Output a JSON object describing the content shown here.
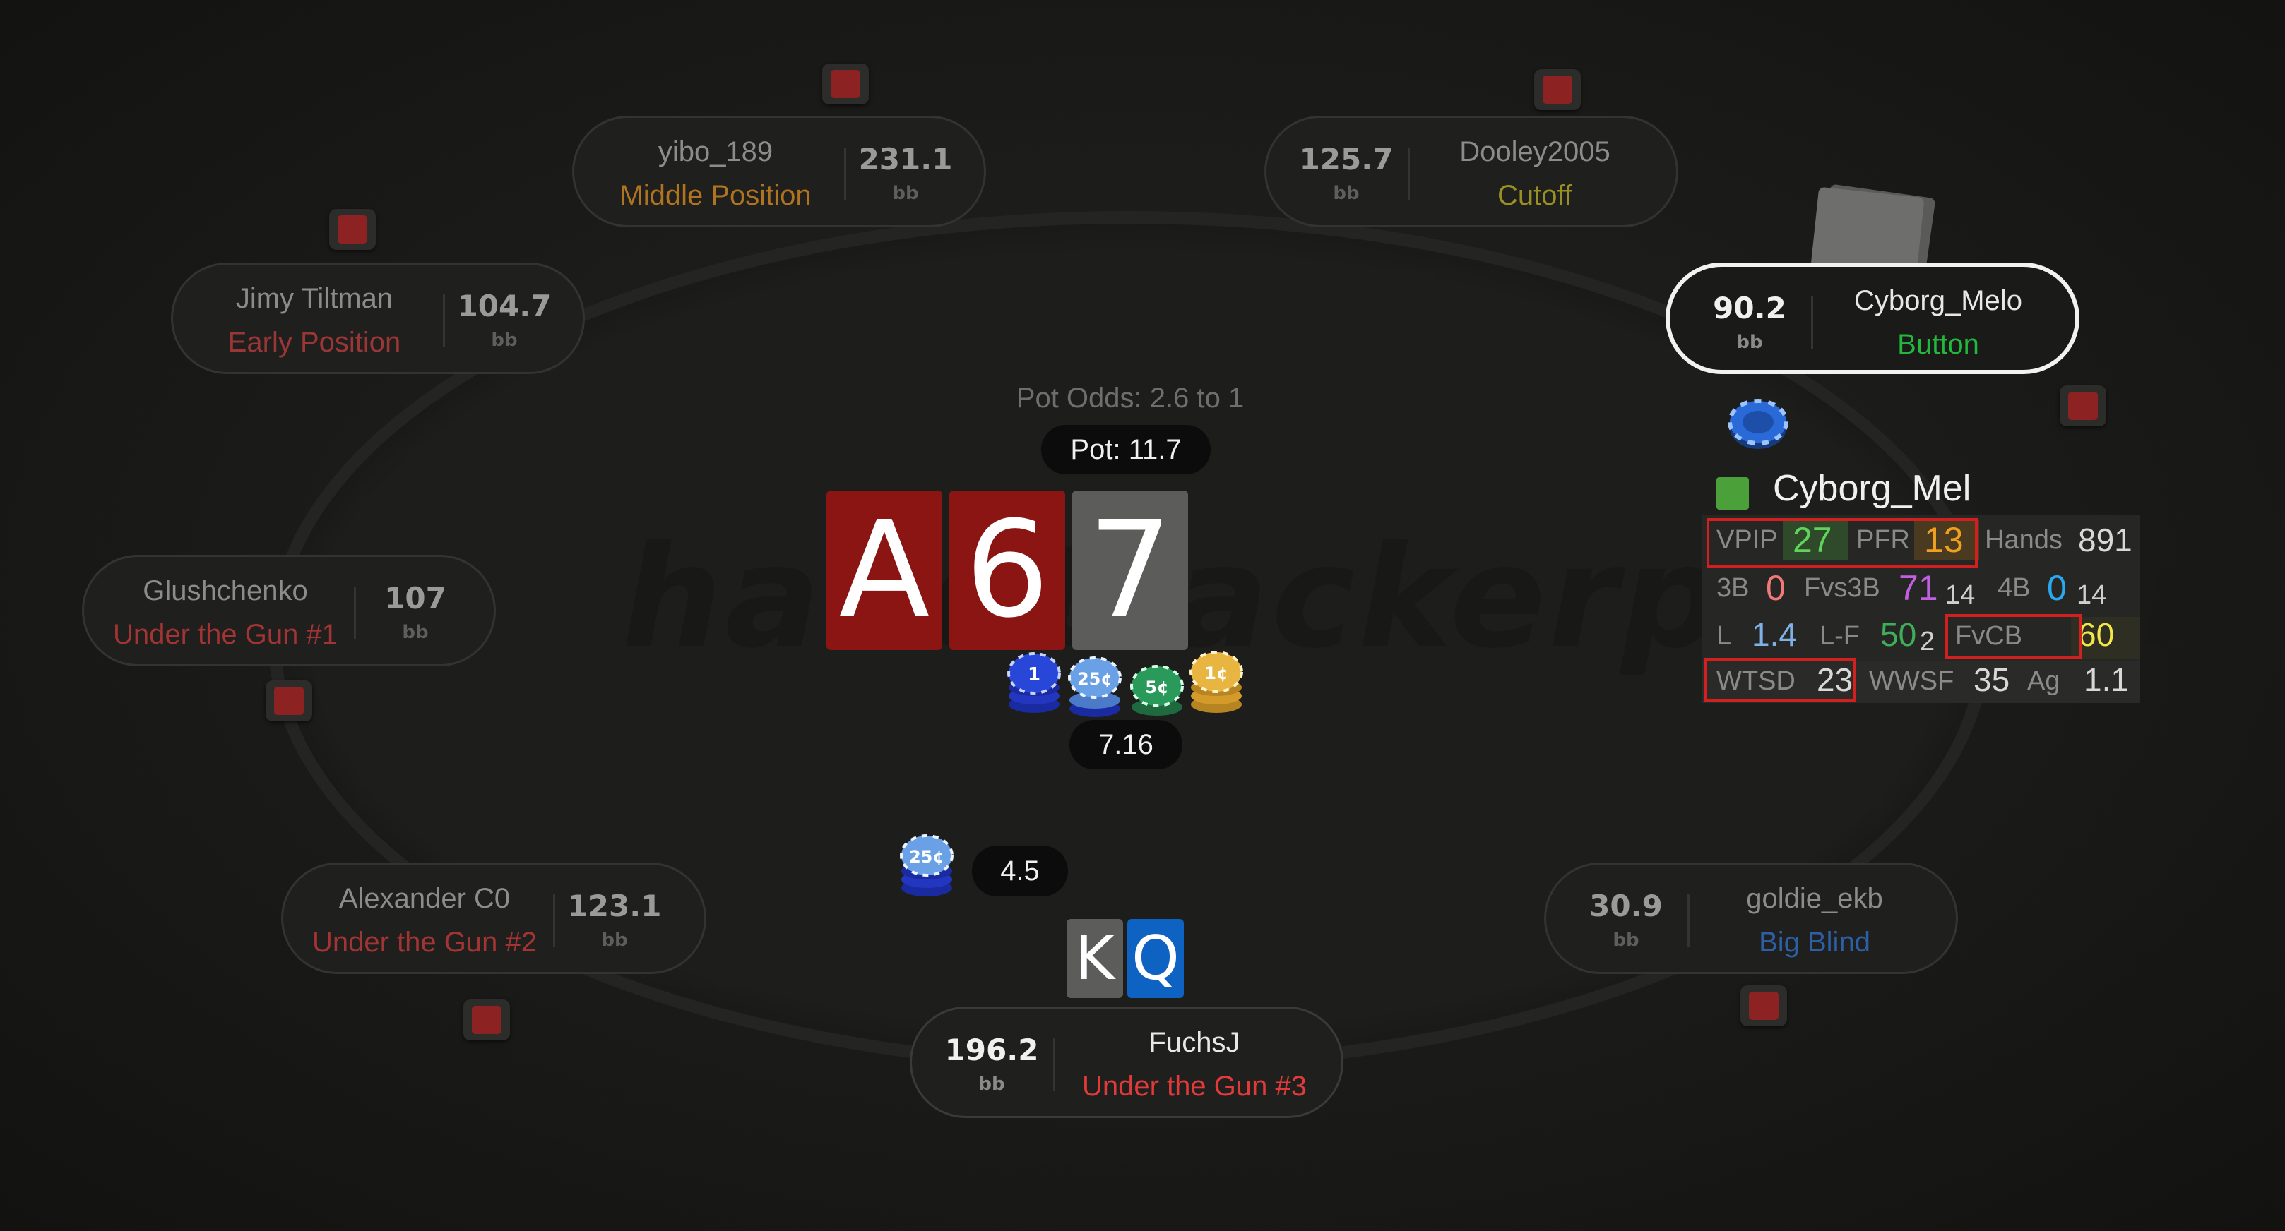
{
  "watermark": "handtrackerpro.com",
  "pot_odds": "Pot Odds: 2.6 to 1",
  "pot": "Pot: 11.7",
  "center_bet": "7.16",
  "hero_bet": "4.5",
  "board": [
    {
      "rank": "A",
      "color": "#8b1512"
    },
    {
      "rank": "6",
      "color": "#8b1512"
    },
    {
      "rank": "7",
      "color": "#5c5c5a"
    }
  ],
  "hero_cards": [
    {
      "rank": "K",
      "color": "#5c5c5a"
    },
    {
      "rank": "Q",
      "color": "#0d62c2"
    }
  ],
  "chips": [
    {
      "label": "1",
      "color": "#2846d8"
    },
    {
      "label": "25¢",
      "color": "#6aa0e6"
    },
    {
      "label": "5¢",
      "color": "#2a9a5a"
    },
    {
      "label": "1¢",
      "color": "#e8b640"
    }
  ],
  "hero_chip": {
    "label": "25¢",
    "color": "#6aa0e6"
  },
  "seats": [
    {
      "name": "yibo_189",
      "position": "Middle Position",
      "stack": "231.1",
      "unit": "bb",
      "pos_color": "#b07320"
    },
    {
      "name": "Dooley2005",
      "position": "Cutoff",
      "stack": "125.7",
      "unit": "bb",
      "pos_color": "#9a8f22"
    },
    {
      "name": "Jimy Tiltman",
      "position": "Early Position",
      "stack": "104.7",
      "unit": "bb",
      "pos_color": "#9a3636"
    },
    {
      "name": "Cyborg_Melo",
      "position": "Button",
      "stack": "90.2",
      "unit": "bb",
      "pos_color": "#22b83c"
    },
    {
      "name": "Glushchenko",
      "position": "Under the Gun #1",
      "stack": "107",
      "unit": "bb",
      "pos_color": "#a33434"
    },
    {
      "name": "Alexander C0",
      "position": "Under the Gun #2",
      "stack": "123.1",
      "unit": "bb",
      "pos_color": "#a33434"
    },
    {
      "name": "goldie_ekb",
      "position": "Big Blind",
      "stack": "30.9",
      "unit": "bb",
      "pos_color": "#2c5fa6"
    },
    {
      "name": "FuchsJ",
      "position": "Under the Gun #3",
      "stack": "196.2",
      "unit": "bb",
      "pos_color": "#e03a3a"
    }
  ],
  "hud": {
    "player": "Cyborg_Mel",
    "vpip_label": "VPIP",
    "vpip": "27",
    "pfr_label": "PFR",
    "pfr": "13",
    "hands_label": "Hands",
    "hands": "891",
    "b3_label": "3B",
    "b3": "0",
    "fvs3b_label": "Fvs3B",
    "fvs3b": "71",
    "fvs3b_n": "14",
    "b4_label": "4B",
    "b4": "0",
    "b4_n": "14",
    "l_label": "L",
    "l": "1.4",
    "lf_label": "L-F",
    "lf": "50",
    "lf_n": "2",
    "fvcb_label": "FvCB",
    "fvcb": "60",
    "wtsd_label": "WTSD",
    "wtsd": "23",
    "wwsf_label": "WWSF",
    "wwsf": "35",
    "ag_label": "Ag",
    "ag": "1.1",
    "colors": {
      "vpip": "#5fd35a",
      "pfr": "#f0a020",
      "b3": "#f07a7a",
      "fvs3b": "#c060e0",
      "b4": "#2aa8f0",
      "l": "#7fb0e6",
      "lf": "#3fae5a",
      "fvcb": "#f2e64a",
      "neutral": "#d8d8d6"
    }
  }
}
